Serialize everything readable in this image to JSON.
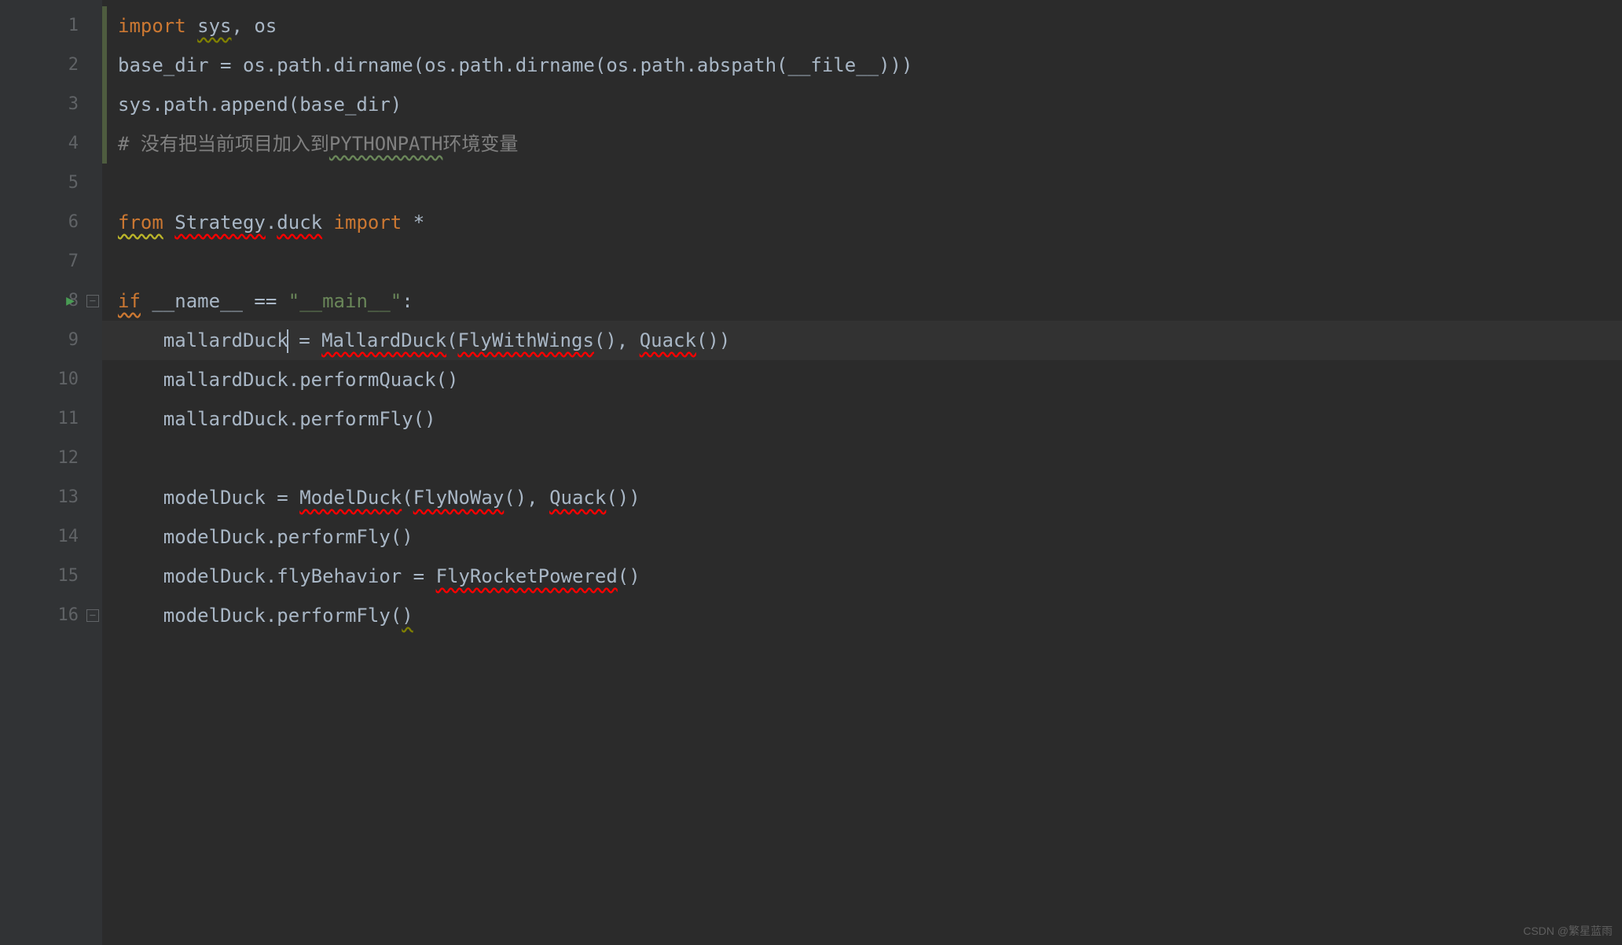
{
  "lines": {
    "1": "1",
    "2": "2",
    "3": "3",
    "4": "4",
    "5": "5",
    "6": "6",
    "7": "7",
    "8": "8",
    "9": "9",
    "10": "10",
    "11": "11",
    "12": "12",
    "13": "13",
    "14": "14",
    "15": "15",
    "16": "16"
  },
  "code": {
    "l1": {
      "import": "import",
      "sys": "sys",
      "comma": ", ",
      "os": "os"
    },
    "l2": {
      "text": "base_dir = os.path.dirname(os.path.dirname(os.path.abspath(__file__)))"
    },
    "l3": {
      "text": "sys.path.append(base_dir)"
    },
    "l4": {
      "hash": "# ",
      "comment1": "没有把当前项目加入到",
      "pythonpath": "PYTHONPATH",
      "comment2": "环境变量"
    },
    "l6": {
      "from": "from",
      "space1": " ",
      "strategy": "Strategy",
      "dot": ".",
      "duck": "duck",
      "space2": " ",
      "import": "import",
      "space3": " ",
      "star": "*"
    },
    "l8": {
      "if": "if",
      "space1": " ",
      "name": "__name__",
      "eq": " == ",
      "main": "\"__main__\"",
      "colon": ":"
    },
    "l9": {
      "indent": "    ",
      "mallardDuck": "mallardDuck",
      "eq": " = ",
      "MallardDuck": "MallardDuck",
      "paren1": "(",
      "FlyWithWings": "FlyWithWings",
      "parens1": "(), ",
      "Quack": "Quack",
      "parens2": "())"
    },
    "l10": {
      "text": "    mallardDuck.performQuack()"
    },
    "l11": {
      "text": "    mallardDuck.performFly()"
    },
    "l13": {
      "indent": "    ",
      "modelDuck": "modelDuck = ",
      "ModelDuck": "ModelDuck",
      "paren1": "(",
      "FlyNoWay": "FlyNoWay",
      "parens1": "(), ",
      "Quack": "Quack",
      "parens2": "())"
    },
    "l14": {
      "text": "    modelDuck.performFly()"
    },
    "l15": {
      "indent": "    modelDuck.flyBehavior = ",
      "FlyRocketPowered": "FlyRocketPowered",
      "parens": "()"
    },
    "l16": {
      "text": "    modelDuck.performFly(",
      "close": ")"
    }
  },
  "watermark": "CSDN @繁星蓝雨"
}
